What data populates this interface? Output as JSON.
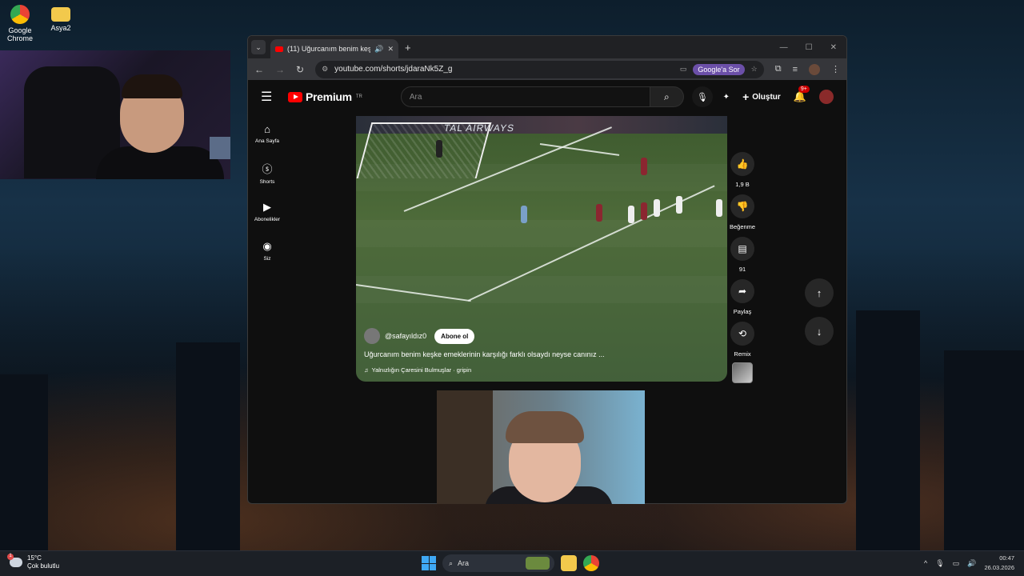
{
  "desktop": {
    "icons": [
      {
        "label": "Google Chrome",
        "icon": "chrome-icon"
      },
      {
        "label": "Asya2",
        "icon": "folder-icon"
      }
    ]
  },
  "browser": {
    "tab": {
      "title": "(11) Uğurcanım benim keşk",
      "icon": "youtube-favicon"
    },
    "url": "youtube.com/shorts/jdaraNk5Z_g",
    "google_ask": "Google'a Sor"
  },
  "youtube": {
    "logo_text": "Premium",
    "region": "TR",
    "search_placeholder": "Ara",
    "create_label": "Oluştur",
    "notification_badge": "9+",
    "guide": [
      {
        "label": "Ana Sayfa",
        "icon": "home-icon"
      },
      {
        "label": "Shorts",
        "icon": "shorts-icon"
      },
      {
        "label": "Abonelikler",
        "icon": "subscriptions-icon"
      },
      {
        "label": "Siz",
        "icon": "you-icon"
      }
    ],
    "short": {
      "ad_text": "TAL AIRWAYS",
      "channel": "@safayıldız0",
      "subscribe": "Abone ol",
      "caption": "Uğurcanım benim keşke emeklerinin karşılığı farklı olsaydı neyse canınız ...",
      "music": "Yalnızlığın Çaresini Bulmuşlar · gripin"
    },
    "actions": [
      {
        "label": "1,9 B",
        "icon": "like-icon"
      },
      {
        "label": "Beğenme",
        "icon": "dislike-icon"
      },
      {
        "label": "91",
        "icon": "comment-icon"
      },
      {
        "label": "Paylaş",
        "icon": "share-icon"
      },
      {
        "label": "Remix",
        "icon": "remix-icon"
      }
    ]
  },
  "taskbar": {
    "weather_temp": "15°C",
    "weather_desc": "Çok bulutlu",
    "weather_badge": "1",
    "search_label": "Ara",
    "time": "00:47",
    "date": "26.03.2026"
  }
}
